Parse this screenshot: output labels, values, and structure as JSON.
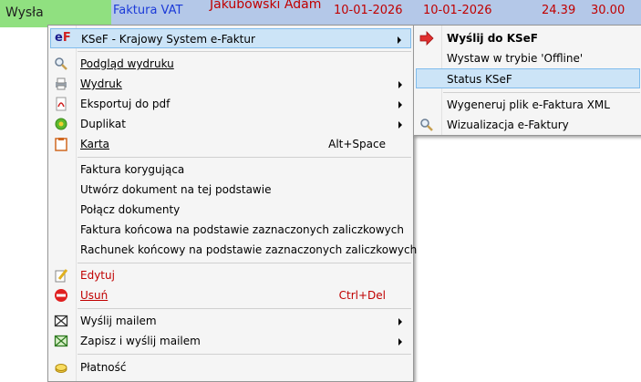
{
  "grid_row": {
    "status": "Wysła",
    "doc_type": "Faktura VAT",
    "customer": "Jakubowski Adam",
    "date1": "10-01-2026",
    "date2": "10-01-2026",
    "amount1": "24.39",
    "amount2": "30.00"
  },
  "context_menu": {
    "items": [
      {
        "label": "KSeF - Krajowy System e-Faktur",
        "icon": "ef-logo-icon"
      },
      {
        "label": "Podgląd wydruku",
        "icon": "magnifier-icon"
      },
      {
        "label": "Wydruk",
        "icon": "printer-icon"
      },
      {
        "label": "Eksportuj do pdf",
        "icon": "pdf-icon"
      },
      {
        "label": "Duplikat",
        "icon": "green-circle-icon"
      },
      {
        "label": "Karta",
        "shortcut": "Alt+Space",
        "icon": "card-icon"
      },
      {
        "label": "Faktura korygująca"
      },
      {
        "label": "Utwórz dokument na tej podstawie"
      },
      {
        "label": "Połącz dokumenty"
      },
      {
        "label": "Faktura końcowa na podstawie zaznaczonych zaliczkowych"
      },
      {
        "label": "Rachunek końcowy na podstawie zaznaczonych zaliczkowych"
      },
      {
        "label": "Edytuj",
        "icon": "edit-pencil-icon"
      },
      {
        "label": "Usuń",
        "shortcut": "Ctrl+Del",
        "icon": "delete-icon"
      },
      {
        "label": "Wyślij mailem",
        "icon": "envelope-icon"
      },
      {
        "label": "Zapisz i wyślij mailem",
        "icon": "envelope-green-icon"
      },
      {
        "label": "Płatność",
        "icon": "payment-icon"
      }
    ]
  },
  "submenu": {
    "items": [
      {
        "label": "Wyślij do KSeF",
        "icon": "red-arrow-icon"
      },
      {
        "label": "Wystaw w trybie 'Offline'"
      },
      {
        "label": "Status KSeF"
      },
      {
        "label": "Wygeneruj plik e-Faktura XML"
      },
      {
        "label": "Wizualizacja e-Faktury",
        "icon": "magnifier-icon"
      }
    ]
  },
  "colors": {
    "highlight": "#cce4f7",
    "highlight_border": "#80bcec",
    "menu_bg": "#f5f5f5",
    "status_green": "#90e080",
    "row_blue": "#b4c8e8",
    "danger_red": "#c00000"
  }
}
